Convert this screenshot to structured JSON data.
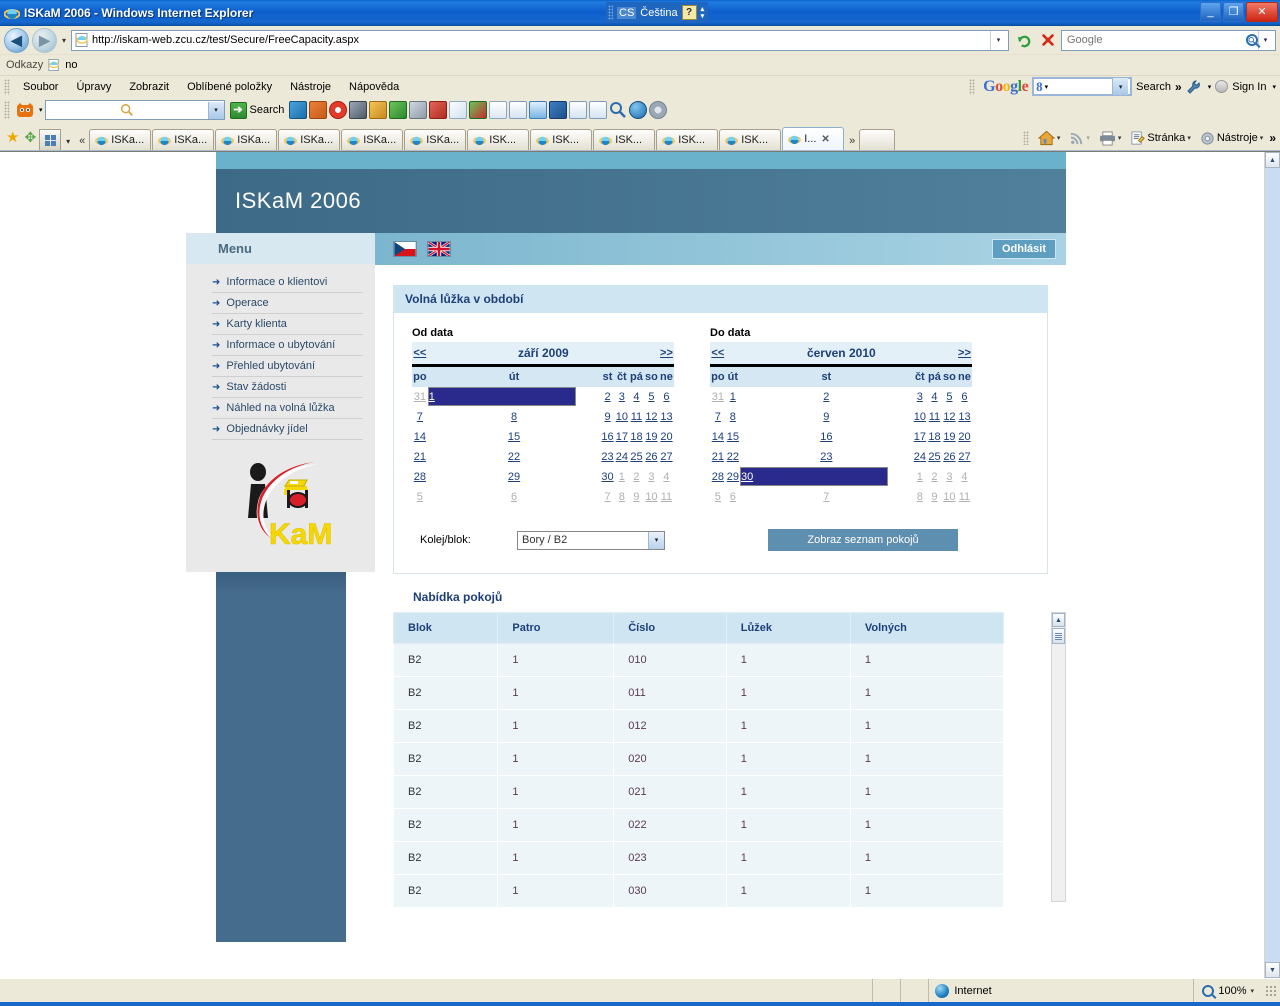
{
  "window": {
    "title": "ISKaM 2006 - Windows Internet Explorer",
    "lang_code": "CS",
    "lang_name": "Čeština",
    "help_glyph": "?",
    "minimize": "_",
    "maximize": "❐",
    "close": "✕"
  },
  "address_bar": {
    "back": "◀",
    "forward": "▶",
    "history_caret": "▾",
    "url": "http://iskam-web.zcu.cz/test/Secure/FreeCapacity.aspx",
    "refresh": "↻",
    "stop": "✕",
    "search_placeholder": "Google",
    "search_value": "",
    "go_caret": "▾"
  },
  "links_bar": {
    "label": "Odkazy",
    "link": "no"
  },
  "menu_bar": {
    "items": [
      "Soubor",
      "Úpravy",
      "Zobrazit",
      "Oblíbené položky",
      "Nástroje",
      "Nápověda"
    ]
  },
  "google_toolbar": {
    "logo": "Google",
    "box_value": "8",
    "search_label": "Search",
    "chevrons": "»",
    "wrench_caret": "▾",
    "signin_label": "Sign In",
    "signin_caret": "▾"
  },
  "addon_toolbar": {
    "search_value": "",
    "go_label": "Search",
    "go_arrow": "➔"
  },
  "tabs": {
    "quick_tabs_caret": "▾",
    "scroll_left": "«",
    "scroll_right": "»",
    "items": [
      {
        "label": "ISKa...",
        "active": false
      },
      {
        "label": "ISKa...",
        "active": false
      },
      {
        "label": "ISKa...",
        "active": false
      },
      {
        "label": "ISKa...",
        "active": false
      },
      {
        "label": "ISKa...",
        "active": false
      },
      {
        "label": "ISKa...",
        "active": false
      },
      {
        "label": "ISK...",
        "active": false
      },
      {
        "label": "ISK...",
        "active": false
      },
      {
        "label": "ISK...",
        "active": false
      },
      {
        "label": "ISK...",
        "active": false
      },
      {
        "label": "ISK...",
        "active": false
      },
      {
        "label": "I...",
        "active": true,
        "close": "✕"
      }
    ],
    "tools": {
      "home_caret": "▾",
      "feeds_caret": "▾",
      "print_caret": "▾",
      "page_label": "Stránka",
      "page_caret": "▾",
      "tools_label": "Nástroje",
      "tools_caret": "▾",
      "overflow": "»"
    }
  },
  "site": {
    "brand": "ISKaM 2006",
    "menu_header": "Menu",
    "menu_items": [
      "Informace o klientovi",
      "Operace",
      "Karty klienta",
      "Informace o ubytování",
      "Přehled ubytování",
      "Stav žádosti",
      "Náhled na volná lůžka",
      "Objednávky jídel"
    ],
    "logo_alt": "iSKaM logo",
    "flags": [
      "cz-flag",
      "gb-flag"
    ],
    "logout_label": "Odhlásit",
    "panel_title": "Volná lůžka v období",
    "calendars": [
      {
        "label": "Od data",
        "prev": "<<",
        "next": ">>",
        "month": "září 2009",
        "dow": [
          "po",
          "út",
          "st",
          "čt",
          "pá",
          "so",
          "ne"
        ],
        "weeks": [
          [
            {
              "d": "31",
              "o": true
            },
            {
              "d": "1",
              "sel": true
            },
            {
              "d": "2"
            },
            {
              "d": "3"
            },
            {
              "d": "4"
            },
            {
              "d": "5"
            },
            {
              "d": "6"
            }
          ],
          [
            {
              "d": "7"
            },
            {
              "d": "8"
            },
            {
              "d": "9"
            },
            {
              "d": "10"
            },
            {
              "d": "11"
            },
            {
              "d": "12"
            },
            {
              "d": "13"
            }
          ],
          [
            {
              "d": "14"
            },
            {
              "d": "15"
            },
            {
              "d": "16"
            },
            {
              "d": "17"
            },
            {
              "d": "18"
            },
            {
              "d": "19"
            },
            {
              "d": "20"
            }
          ],
          [
            {
              "d": "21"
            },
            {
              "d": "22"
            },
            {
              "d": "23"
            },
            {
              "d": "24"
            },
            {
              "d": "25"
            },
            {
              "d": "26"
            },
            {
              "d": "27"
            }
          ],
          [
            {
              "d": "28"
            },
            {
              "d": "29"
            },
            {
              "d": "30"
            },
            {
              "d": "1",
              "o": true
            },
            {
              "d": "2",
              "o": true
            },
            {
              "d": "3",
              "o": true
            },
            {
              "d": "4",
              "o": true
            }
          ],
          [
            {
              "d": "5",
              "o": true
            },
            {
              "d": "6",
              "o": true
            },
            {
              "d": "7",
              "o": true
            },
            {
              "d": "8",
              "o": true
            },
            {
              "d": "9",
              "o": true
            },
            {
              "d": "10",
              "o": true
            },
            {
              "d": "11",
              "o": true
            }
          ]
        ]
      },
      {
        "label": "Do data",
        "prev": "<<",
        "next": ">>",
        "month": "červen 2010",
        "dow": [
          "po",
          "út",
          "st",
          "čt",
          "pá",
          "so",
          "ne"
        ],
        "weeks": [
          [
            {
              "d": "31",
              "o": true
            },
            {
              "d": "1"
            },
            {
              "d": "2"
            },
            {
              "d": "3"
            },
            {
              "d": "4"
            },
            {
              "d": "5"
            },
            {
              "d": "6"
            }
          ],
          [
            {
              "d": "7"
            },
            {
              "d": "8"
            },
            {
              "d": "9"
            },
            {
              "d": "10"
            },
            {
              "d": "11"
            },
            {
              "d": "12"
            },
            {
              "d": "13"
            }
          ],
          [
            {
              "d": "14"
            },
            {
              "d": "15"
            },
            {
              "d": "16"
            },
            {
              "d": "17"
            },
            {
              "d": "18"
            },
            {
              "d": "19"
            },
            {
              "d": "20"
            }
          ],
          [
            {
              "d": "21"
            },
            {
              "d": "22"
            },
            {
              "d": "23"
            },
            {
              "d": "24"
            },
            {
              "d": "25"
            },
            {
              "d": "26"
            },
            {
              "d": "27"
            }
          ],
          [
            {
              "d": "28"
            },
            {
              "d": "29"
            },
            {
              "d": "30",
              "sel": true
            },
            {
              "d": "1",
              "o": true
            },
            {
              "d": "2",
              "o": true
            },
            {
              "d": "3",
              "o": true
            },
            {
              "d": "4",
              "o": true
            }
          ],
          [
            {
              "d": "5",
              "o": true
            },
            {
              "d": "6",
              "o": true
            },
            {
              "d": "7",
              "o": true
            },
            {
              "d": "8",
              "o": true
            },
            {
              "d": "9",
              "o": true
            },
            {
              "d": "10",
              "o": true
            },
            {
              "d": "11",
              "o": true
            }
          ]
        ]
      }
    ],
    "select_label": "Kolej/blok:",
    "select_value": "Bory / B2",
    "select_caret": "▾",
    "show_button": "Zobraz seznam pokojů",
    "rooms_title": "Nabídka pokojů",
    "table": {
      "headers": [
        "Blok",
        "Patro",
        "Číslo",
        "Lůžek",
        "Volných"
      ],
      "rows": [
        [
          "B2",
          "1",
          "010",
          "1",
          "1"
        ],
        [
          "B2",
          "1",
          "011",
          "1",
          "1"
        ],
        [
          "B2",
          "1",
          "012",
          "1",
          "1"
        ],
        [
          "B2",
          "1",
          "020",
          "1",
          "1"
        ],
        [
          "B2",
          "1",
          "021",
          "1",
          "1"
        ],
        [
          "B2",
          "1",
          "022",
          "1",
          "1"
        ],
        [
          "B2",
          "1",
          "023",
          "1",
          "1"
        ],
        [
          "B2",
          "1",
          "030",
          "1",
          "1"
        ]
      ]
    }
  },
  "status_bar": {
    "zone": "Internet",
    "zoom": "100%",
    "zoom_caret": "▾"
  },
  "colors": {
    "accent_blue": "#1d3f7a",
    "banner": "#456b8d",
    "panel_header": "#cfe5f2",
    "selected_day": "#2a2a8c",
    "button": "#5e8fb0"
  }
}
